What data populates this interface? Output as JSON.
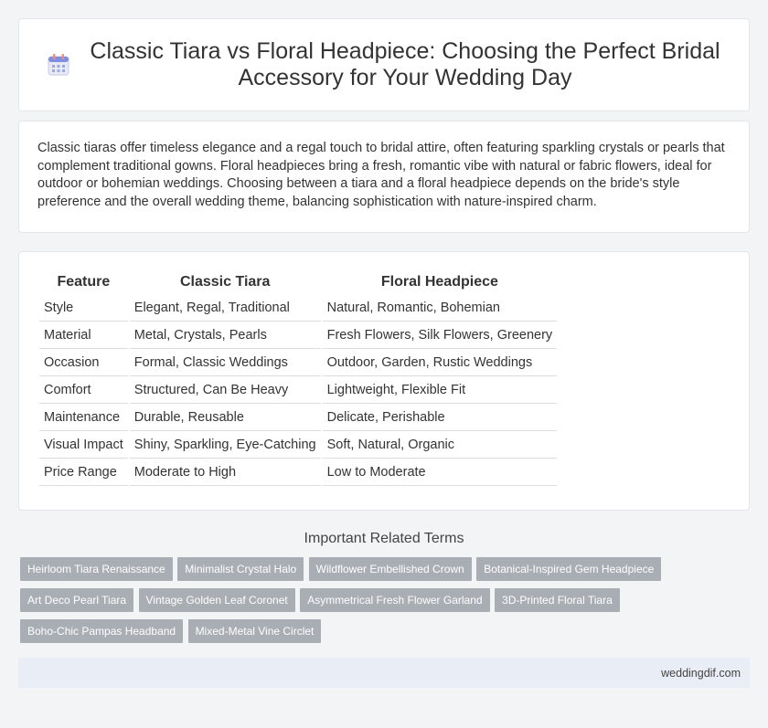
{
  "header": {
    "title": "Classic Tiara vs Floral Headpiece: Choosing the Perfect Bridal Accessory for Your Wedding Day",
    "icon": "calendar-icon"
  },
  "summary": "Classic tiaras offer timeless elegance and a regal touch to bridal attire, often featuring sparkling crystals or pearls that complement traditional gowns. Floral headpieces bring a fresh, romantic vibe with natural or fabric flowers, ideal for outdoor or bohemian weddings. Choosing between a tiara and a floral headpiece depends on the bride's style preference and the overall wedding theme, balancing sophistication with nature-inspired charm.",
  "table": {
    "headers": [
      "Feature",
      "Classic Tiara",
      "Floral Headpiece"
    ],
    "rows": [
      [
        "Style",
        "Elegant, Regal, Traditional",
        "Natural, Romantic, Bohemian"
      ],
      [
        "Material",
        "Metal, Crystals, Pearls",
        "Fresh Flowers, Silk Flowers, Greenery"
      ],
      [
        "Occasion",
        "Formal, Classic Weddings",
        "Outdoor, Garden, Rustic Weddings"
      ],
      [
        "Comfort",
        "Structured, Can Be Heavy",
        "Lightweight, Flexible Fit"
      ],
      [
        "Maintenance",
        "Durable, Reusable",
        "Delicate, Perishable"
      ],
      [
        "Visual Impact",
        "Shiny, Sparkling, Eye-Catching",
        "Soft, Natural, Organic"
      ],
      [
        "Price Range",
        "Moderate to High",
        "Low to Moderate"
      ]
    ]
  },
  "related": {
    "title": "Important Related Terms",
    "tags": [
      "Heirloom Tiara Renaissance",
      "Minimalist Crystal Halo",
      "Wildflower Embellished Crown",
      "Botanical-Inspired Gem Headpiece",
      "Art Deco Pearl Tiara",
      "Vintage Golden Leaf Coronet",
      "Asymmetrical Fresh Flower Garland",
      "3D-Printed Floral Tiara",
      "Boho-Chic Pampas Headband",
      "Mixed-Metal Vine Circlet"
    ]
  },
  "footer": {
    "site": "weddingdif.com"
  },
  "colors": {
    "tag_bg": "#a9adb4",
    "footer_bg": "#e8edf6",
    "page_bg": "#f3f4f6"
  }
}
